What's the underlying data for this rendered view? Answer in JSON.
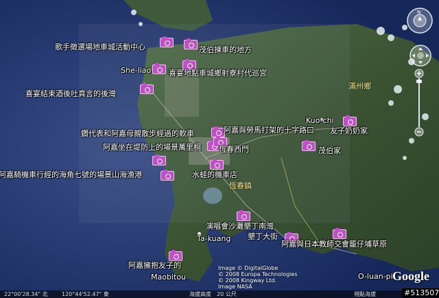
{
  "markers": [
    {
      "label": "歌手徵選場地車城活動中心"
    },
    {
      "label": "茂伯揀車的地方"
    },
    {
      "label": "喜宴地點車城鄉射寮村代巡宮"
    },
    {
      "label": "喜宴結束酒後吐真言的後灣"
    },
    {
      "label": "鑽代表和阿嘉母親散步經過的軟車"
    },
    {
      "label": "阿嘉坐在堤防上的場景萬里桐"
    },
    {
      "label": "阿嘉與勞馬打架的十字路口"
    },
    {
      "label": "友子奶奶家"
    },
    {
      "label": "恆春西門"
    },
    {
      "label": "茂伯家"
    },
    {
      "label": "水蛙的機車店"
    },
    {
      "label": "阿嘉騎機車行經的海角七號的場景山海漁港"
    },
    {
      "label": "演唱會沙灘墾丁南灣"
    },
    {
      "label": "墾丁大街"
    },
    {
      "label": "阿嘉與日本教師交會籠仔埔草原"
    },
    {
      "label": "阿嘉擁抱友子的"
    }
  ],
  "places": {
    "sheliao": "She-liao",
    "kuochi": "Kuo-chi",
    "hengchun": "恆春鎮",
    "manzhou": "滿州鄉",
    "takuang": "Ta-kuang",
    "maobitou": "Maobitou",
    "oluanpi": "O-luan-pi"
  },
  "credits": {
    "line1": "Image © DigitalGlobe",
    "line2": "© 2008 Europa Technologies",
    "line3": "© 2008 Kingway Ltd.",
    "line4": "Image NASA"
  },
  "logo": "Google",
  "status": {
    "lat": "22°00'28.34\" 北",
    "lon": "120°44'52.47\" 東",
    "elevation": "海拔高度　20 公尺",
    "eye": "視點海拔"
  },
  "image_id": "#513507",
  "colors": {
    "ocean": "#1b2f5c",
    "land": "#3f5a36",
    "marker": "#c050c8"
  }
}
